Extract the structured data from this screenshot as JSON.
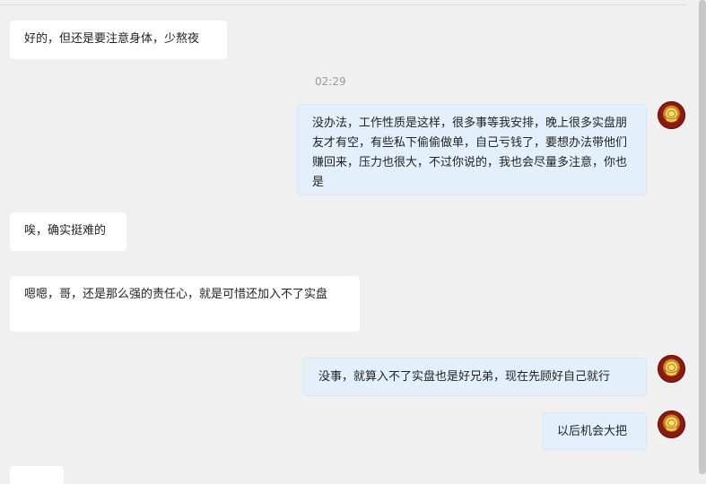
{
  "timestamp": "02:29",
  "messages": [
    {
      "side": "left",
      "text": "好的，但还是要注意身体，少熬夜"
    },
    {
      "side": "right",
      "text": "没办法，工作性质是这样，很多事等我安排，晚上很多实盘朋友才有空，有些私下偷偷做单，自己亏钱了，要想办法带他们赚回来，压力也很大，不过你说的，我也会尽量多注意，你也是"
    },
    {
      "side": "left",
      "text": "唉，确实挺难的"
    },
    {
      "side": "left",
      "text": "嗯嗯，哥，还是那么强的责任心，就是可惜还加入不了实盘"
    },
    {
      "side": "right",
      "text": "没事，就算入不了实盘也是好兄弟，现在先顾好自己就行"
    },
    {
      "side": "right",
      "text": "以后机会大把"
    }
  ],
  "icons": {
    "avatar": "gold-ingot-avatar-icon"
  }
}
